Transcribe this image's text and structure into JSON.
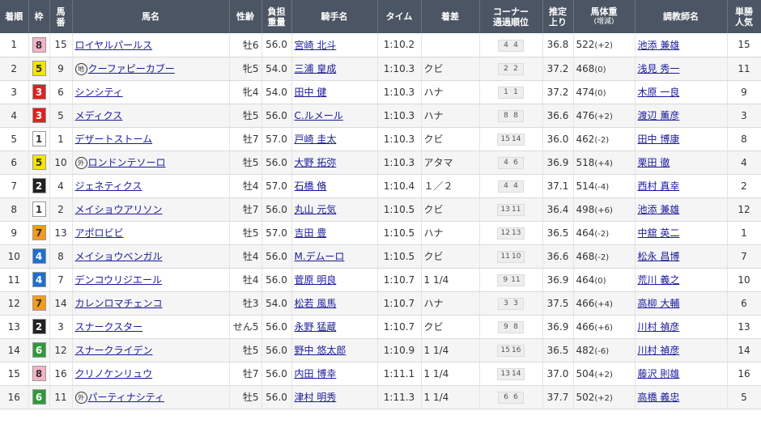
{
  "headers": {
    "rank": "着順",
    "frame": "枠",
    "horse_num": [
      "馬",
      "番"
    ],
    "horse": "馬名",
    "sex_age": "性齢",
    "weight_carried": [
      "負担",
      "重量"
    ],
    "jockey": "騎手名",
    "time": "タイム",
    "margin": "着差",
    "corner": [
      "コーナー",
      "通過順位"
    ],
    "last3f": [
      "推定",
      "上り"
    ],
    "body_weight": [
      "馬体重",
      "(増減)"
    ],
    "trainer": "調教師名",
    "popularity": [
      "単勝",
      "人気"
    ]
  },
  "frame_colors": {
    "1": {
      "bg": "#ffffff",
      "fg": "#333333"
    },
    "2": {
      "bg": "#222222",
      "fg": "#ffffff"
    },
    "3": {
      "bg": "#e02020",
      "fg": "#ffffff"
    },
    "4": {
      "bg": "#1e6fd0",
      "fg": "#ffffff"
    },
    "5": {
      "bg": "#f5e400",
      "fg": "#333333"
    },
    "6": {
      "bg": "#2f9a3a",
      "fg": "#ffffff"
    },
    "7": {
      "bg": "#f59a1c",
      "fg": "#333333"
    },
    "8": {
      "bg": "#f7b3c6",
      "fg": "#333333"
    }
  },
  "rows": [
    {
      "rank": "1",
      "frame": "8",
      "num": "15",
      "mark": "",
      "horse": "ロイヤルパールス",
      "sex_age": "牡6",
      "weight": "56.0",
      "jockey": "宮崎 北斗",
      "time": "1:10.2",
      "margin": "",
      "corner": [
        "4",
        "4"
      ],
      "last3f": "36.8",
      "bw": "522",
      "bw_chg": "(+2)",
      "trainer": "池添 兼雄",
      "pop": "15"
    },
    {
      "rank": "2",
      "frame": "5",
      "num": "9",
      "mark": "地",
      "horse": "クーファピーカブー",
      "sex_age": "牝5",
      "weight": "54.0",
      "jockey": "三浦 皇成",
      "time": "1:10.3",
      "margin": "クビ",
      "corner": [
        "2",
        "2"
      ],
      "last3f": "37.2",
      "bw": "468",
      "bw_chg": "(0)",
      "trainer": "浅見 秀一",
      "pop": "11"
    },
    {
      "rank": "3",
      "frame": "3",
      "num": "6",
      "mark": "",
      "horse": "シンシティ",
      "sex_age": "牝4",
      "weight": "54.0",
      "jockey": "田中 健",
      "time": "1:10.3",
      "margin": "ハナ",
      "corner": [
        "1",
        "1"
      ],
      "last3f": "37.2",
      "bw": "474",
      "bw_chg": "(0)",
      "trainer": "木原 一良",
      "pop": "9"
    },
    {
      "rank": "4",
      "frame": "3",
      "num": "5",
      "mark": "",
      "horse": "メディクス",
      "sex_age": "牡5",
      "weight": "56.0",
      "jockey": "C.ルメール",
      "time": "1:10.3",
      "margin": "ハナ",
      "corner": [
        "8",
        "8"
      ],
      "last3f": "36.6",
      "bw": "476",
      "bw_chg": "(+2)",
      "trainer": "渡辺 薫彦",
      "pop": "3"
    },
    {
      "rank": "5",
      "frame": "1",
      "num": "1",
      "mark": "",
      "horse": "デザートストーム",
      "sex_age": "牡7",
      "weight": "57.0",
      "jockey": "戸崎 圭太",
      "time": "1:10.3",
      "margin": "クビ",
      "corner": [
        "15",
        "14"
      ],
      "last3f": "36.0",
      "bw": "462",
      "bw_chg": "(-2)",
      "trainer": "田中 博康",
      "pop": "8"
    },
    {
      "rank": "6",
      "frame": "5",
      "num": "10",
      "mark": "外",
      "horse": "ロンドンテソーロ",
      "sex_age": "牡5",
      "weight": "56.0",
      "jockey": "大野 拓弥",
      "time": "1:10.3",
      "margin": "アタマ",
      "corner": [
        "4",
        "6"
      ],
      "last3f": "36.9",
      "bw": "518",
      "bw_chg": "(+4)",
      "trainer": "栗田 徹",
      "pop": "4"
    },
    {
      "rank": "7",
      "frame": "2",
      "num": "4",
      "mark": "",
      "horse": "ジェネティクス",
      "sex_age": "牡4",
      "weight": "57.0",
      "jockey": "石橋 脩",
      "time": "1:10.4",
      "margin": "１／２",
      "corner": [
        "4",
        "4"
      ],
      "last3f": "37.1",
      "bw": "514",
      "bw_chg": "(-4)",
      "trainer": "西村 真幸",
      "pop": "2"
    },
    {
      "rank": "8",
      "frame": "1",
      "num": "2",
      "mark": "",
      "horse": "メイショウアリソン",
      "sex_age": "牡7",
      "weight": "56.0",
      "jockey": "丸山 元気",
      "time": "1:10.5",
      "margin": "クビ",
      "corner": [
        "13",
        "11"
      ],
      "last3f": "36.4",
      "bw": "498",
      "bw_chg": "(+6)",
      "trainer": "池添 兼雄",
      "pop": "12"
    },
    {
      "rank": "9",
      "frame": "7",
      "num": "13",
      "mark": "",
      "horse": "アポロビビ",
      "sex_age": "牡5",
      "weight": "57.0",
      "jockey": "吉田 豊",
      "time": "1:10.5",
      "margin": "ハナ",
      "corner": [
        "12",
        "13"
      ],
      "last3f": "36.5",
      "bw": "464",
      "bw_chg": "(-2)",
      "trainer": "中舘 英二",
      "pop": "1"
    },
    {
      "rank": "10",
      "frame": "4",
      "num": "8",
      "mark": "",
      "horse": "メイショウベンガル",
      "sex_age": "牡4",
      "weight": "56.0",
      "jockey": "M.デムーロ",
      "time": "1:10.5",
      "margin": "クビ",
      "corner": [
        "11",
        "10"
      ],
      "last3f": "36.6",
      "bw": "468",
      "bw_chg": "(-2)",
      "trainer": "松永 昌博",
      "pop": "7"
    },
    {
      "rank": "11",
      "frame": "4",
      "num": "7",
      "mark": "",
      "horse": "デンコウリジエール",
      "sex_age": "牡4",
      "weight": "56.0",
      "jockey": "菅原 明良",
      "time": "1:10.7",
      "margin": "1 1/4",
      "corner": [
        "9",
        "11"
      ],
      "last3f": "36.9",
      "bw": "464",
      "bw_chg": "(0)",
      "trainer": "荒川 義之",
      "pop": "10"
    },
    {
      "rank": "12",
      "frame": "7",
      "num": "14",
      "mark": "",
      "horse": "カレンロマチェンコ",
      "sex_age": "牡3",
      "weight": "54.0",
      "jockey": "松若 風馬",
      "time": "1:10.7",
      "margin": "ハナ",
      "corner": [
        "3",
        "3"
      ],
      "last3f": "37.5",
      "bw": "466",
      "bw_chg": "(+4)",
      "trainer": "高柳 大輔",
      "pop": "6"
    },
    {
      "rank": "13",
      "frame": "2",
      "num": "3",
      "mark": "",
      "horse": "スナークスター",
      "sex_age": "せん5",
      "weight": "56.0",
      "jockey": "永野 猛蔵",
      "time": "1:10.7",
      "margin": "クビ",
      "corner": [
        "9",
        "8"
      ],
      "last3f": "36.9",
      "bw": "466",
      "bw_chg": "(+6)",
      "trainer": "川村 禎彦",
      "pop": "13"
    },
    {
      "rank": "14",
      "frame": "6",
      "num": "12",
      "mark": "",
      "horse": "スナークライデン",
      "sex_age": "牡5",
      "weight": "56.0",
      "jockey": "野中 悠太郎",
      "time": "1:10.9",
      "margin": "1 1/4",
      "corner": [
        "15",
        "16"
      ],
      "last3f": "36.5",
      "bw": "482",
      "bw_chg": "(-6)",
      "trainer": "川村 禎彦",
      "pop": "14"
    },
    {
      "rank": "15",
      "frame": "8",
      "num": "16",
      "mark": "",
      "horse": "クリノケンリュウ",
      "sex_age": "牡7",
      "weight": "56.0",
      "jockey": "内田 博幸",
      "time": "1:11.1",
      "margin": "1 1/4",
      "corner": [
        "13",
        "14"
      ],
      "last3f": "37.0",
      "bw": "504",
      "bw_chg": "(+2)",
      "trainer": "藤沢 則雄",
      "pop": "16"
    },
    {
      "rank": "16",
      "frame": "6",
      "num": "11",
      "mark": "外",
      "horse": "パーティナシティ",
      "sex_age": "牡5",
      "weight": "56.0",
      "jockey": "津村 明秀",
      "time": "1:11.3",
      "margin": "1 1/4",
      "corner": [
        "6",
        "6"
      ],
      "last3f": "37.7",
      "bw": "502",
      "bw_chg": "(+2)",
      "trainer": "高橋 義忠",
      "pop": "5"
    }
  ]
}
